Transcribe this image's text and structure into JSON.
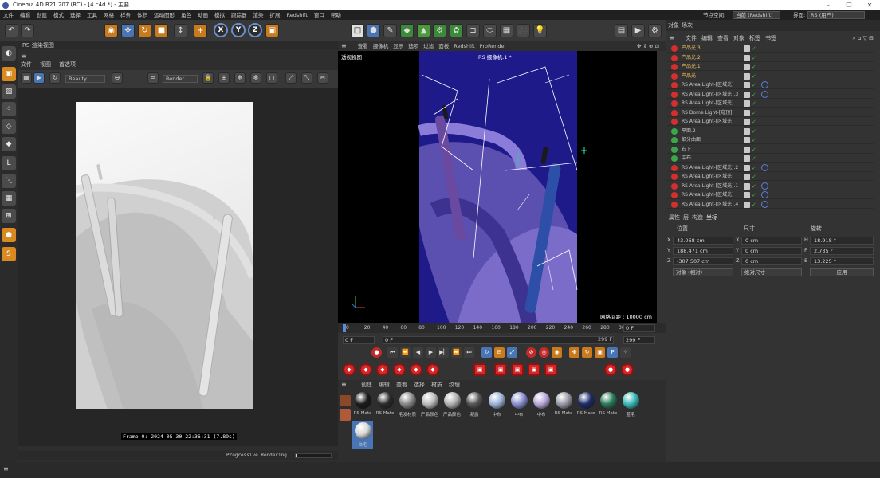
{
  "window": {
    "title": "Cinema 4D R21.207 (RC) - [4.c4d *] - 主要"
  },
  "menubar": {
    "items": [
      "文件",
      "编辑",
      "创建",
      "模式",
      "选择",
      "工具",
      "网格",
      "样条",
      "体积",
      "运动图形",
      "角色",
      "动画",
      "模拟",
      "跟踪器",
      "渲染",
      "扩展",
      "Redshift",
      "窗口",
      "帮助"
    ],
    "node_space_label": "节点空间:",
    "node_space_value": "当前 (Redshift)",
    "interface_label": "界面:",
    "interface_value": "RS (用户)"
  },
  "render_view": {
    "title": "RS-渲染视图",
    "menu": [
      "文件",
      "视图",
      "首选项"
    ],
    "aov": "Beauty",
    "render_mode": "Render",
    "frame_info": "Frame  0:  2024-05-30  22:36:31  (7.89s)",
    "status": "Progressive Rendering...",
    "progress": 0.05
  },
  "viewport": {
    "menu": [
      "查看",
      "摄像机",
      "显示",
      "选项",
      "过滤",
      "面板",
      "Redshift",
      "ProRender"
    ],
    "label": "透视视图",
    "camera": "RS 摄像机.1 *",
    "grid_info": "网格间距 : 10000 cm"
  },
  "timeline": {
    "ticks": [
      "0",
      "20",
      "40",
      "60",
      "80",
      "100",
      "120",
      "140",
      "160",
      "180",
      "200",
      "220",
      "240",
      "260",
      "280",
      "30"
    ],
    "current_frame": "0 F",
    "start": "0 F",
    "min_field": "0 F",
    "end": "299 F",
    "max_field": "299 F"
  },
  "material": {
    "menu": [
      "创建",
      "编辑",
      "查看",
      "选择",
      "材质",
      "纹理"
    ],
    "items": [
      {
        "name": "RS Mate",
        "color": "#1a1a1a"
      },
      {
        "name": "RS Mate",
        "color": "#2a2a2a"
      },
      {
        "name": "毛发材质",
        "color": "#888888"
      },
      {
        "name": "产品颜色",
        "color": "#bbbbbb"
      },
      {
        "name": "产品颜色",
        "color": "#b0b0b0"
      },
      {
        "name": "凝露",
        "color": "#555555"
      },
      {
        "name": "中布",
        "color": "#9db4d8"
      },
      {
        "name": "中布",
        "color": "#8a8fd0"
      },
      {
        "name": "中布",
        "color": "#b8a8d8"
      },
      {
        "name": "RS Mate",
        "color": "#9a9aa8"
      },
      {
        "name": "RS Mate",
        "color": "#1e2a6a"
      },
      {
        "name": "RS Mate",
        "color": "#2a7a5a"
      },
      {
        "name": "蓝毛",
        "color": "#3ab8b8"
      },
      {
        "name": "白毛",
        "color": "#d8d8d8"
      }
    ]
  },
  "object_manager": {
    "tabs": [
      "对象",
      "场次"
    ],
    "menu": [
      "文件",
      "编辑",
      "查看",
      "对象",
      "标签",
      "书签"
    ],
    "objects": [
      "产品光.3",
      "产品光.2",
      "产品光.1",
      "产品光",
      "RS Area Light-[区域光]",
      "RS Area Light-[区域光].3",
      "RS Area Light-[区域光]",
      "RS Dome Light-[穹顶]",
      "RS Area Light-[区域光]",
      "平面.2",
      "细分曲面",
      "右下",
      "中布",
      "RS Area Light-[区域光].2",
      "RS Area Light-[区域光]",
      "RS Area Light-[区域光].1",
      "RS Area Light-[区域光]",
      "RS Area Light-[区域光].4"
    ]
  },
  "attributes": {
    "tabs": [
      "属性",
      "层",
      "构造",
      "坐标"
    ],
    "col_pos": "位置",
    "col_size": "尺寸",
    "col_rot": "旋转",
    "x": "43.068 cm",
    "y": "188.471 cm",
    "z": "-307.507 cm",
    "sx": "0 cm",
    "sy": "0 cm",
    "sz": "0 cm",
    "h": "18.918 °",
    "p": "2.735 °",
    "b": "13.225 °",
    "mode1": "对象 (相对)",
    "mode2": "绝对尺寸",
    "apply": "应用"
  }
}
